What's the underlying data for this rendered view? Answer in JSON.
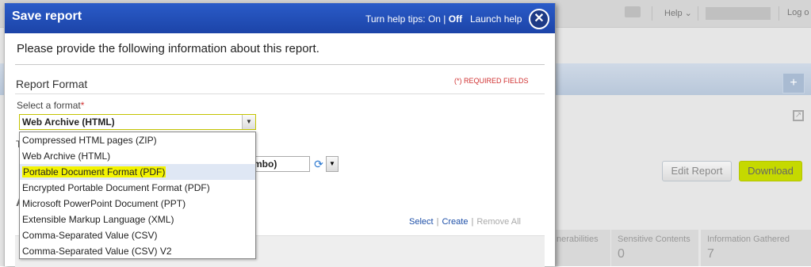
{
  "background": {
    "topbar": {
      "mail_icon": "mail-icon",
      "help_label": "Help",
      "logout_label": "Log o"
    },
    "band_button": "+",
    "edit_report_label": "Edit Report",
    "download_label": "Download",
    "cards": [
      {
        "title": "nerabilities",
        "value": ""
      },
      {
        "title": "Sensitive Contents",
        "value": "0"
      },
      {
        "title": "Information Gathered",
        "value": "7"
      }
    ]
  },
  "dialog": {
    "title": "Save report",
    "help_tips_label": "Turn help tips:",
    "help_tips_on": "On",
    "help_tips_sep": "|",
    "help_tips_off": "Off",
    "launch_help": "Launch help",
    "close_glyph": "✕",
    "intro": "Please provide the following information about this report.",
    "section_title": "Report Format",
    "required_note": "(*) REQUIRED FIELDS",
    "format_label": "Select a format",
    "required_star": "*",
    "format_selected": "Web Archive (HTML)",
    "format_options": [
      "Compressed HTML pages (ZIP)",
      "Web Archive (HTML)",
      "Portable Document Format (PDF)",
      "Encrypted Portable Document Format (PDF)",
      "Microsoft PowerPoint Document (PPT)",
      "Extensible Markup Language (XML)",
      "Comma-Separated Value (CSV)",
      "Comma-Separated Value (CSV) V2"
    ],
    "highlighted_option_index": 2,
    "obscured": {
      "field_label_initial": "T",
      "combo_text": "mbo)",
      "section_initial": "A"
    },
    "links": {
      "select": "Select",
      "create": "Create",
      "remove_all": "Remove All"
    }
  },
  "colors": {
    "dialog_header": "#1f4db5",
    "select_border": "#c3c300",
    "highlight": "#f3f300",
    "download_button": "#c5d900",
    "link": "#1d4fa8",
    "required": "#d03030"
  }
}
